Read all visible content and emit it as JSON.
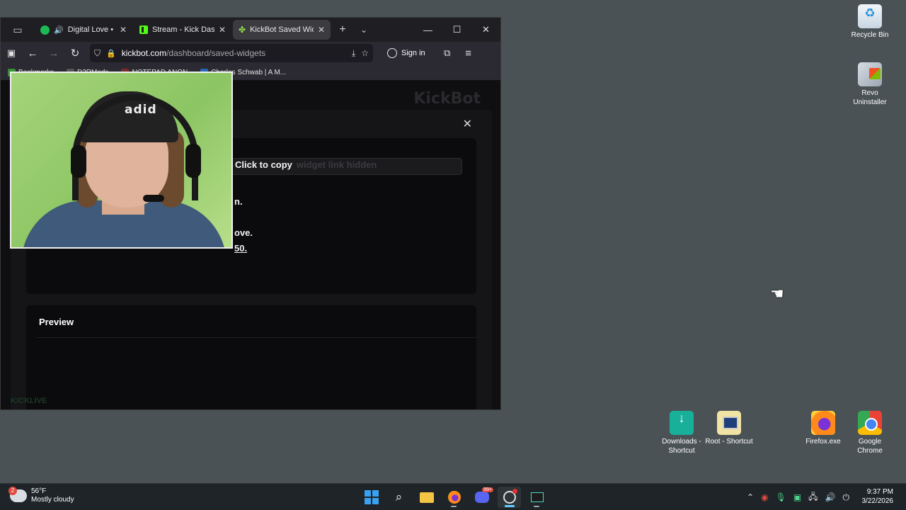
{
  "browser": {
    "tabs": [
      {
        "title": "Digital Love • Daft Punk",
        "favicon": "spotify-icon",
        "audio": true,
        "active": false
      },
      {
        "title": "Stream - Kick Dashboard",
        "favicon": "kick-icon",
        "audio": false,
        "active": false
      },
      {
        "title": "KickBot Saved Widgets",
        "favicon": "kickbot-icon",
        "audio": false,
        "active": true
      }
    ],
    "url": {
      "domain": "kickbot.com",
      "path": "/dashboard/saved-widgets"
    },
    "sign_in_label": "Sign in",
    "bookmarks": [
      {
        "label": "Bookmarks",
        "color": "#3a8f3a"
      },
      {
        "label": "D2RMods",
        "color": "#444"
      },
      {
        "label": "NOTEPAD ANON",
        "color": "#7a2a2a"
      },
      {
        "label": "Charles Schwab | A M...",
        "color": "#2a66b8"
      }
    ]
  },
  "page": {
    "bg_logo": "KickBot",
    "copy_button": "Click to copy",
    "copy_blurred": "widget link hidden",
    "line1": "n.",
    "line2": "ove.",
    "line3": "50.",
    "preview_title": "Preview",
    "footer": "KICKLIVE"
  },
  "webcam": {
    "beanie_text": "adid"
  },
  "desktop": {
    "icons": [
      {
        "label": "Recycle Bin",
        "icon": "recycle-bin-icon"
      },
      {
        "label": "Revo Uninstaller",
        "icon": "revo-uninstaller-icon"
      },
      {
        "label": "Downloads - Shortcut",
        "icon": "downloads-folder-icon"
      },
      {
        "label": "Root - Shortcut",
        "icon": "root-folder-icon"
      },
      {
        "label": "Firefox.exe",
        "icon": "firefox-icon"
      },
      {
        "label": "Google Chrome",
        "icon": "chrome-icon"
      }
    ]
  },
  "taskbar": {
    "weather_temp": "56°F",
    "weather_desc": "Mostly cloudy",
    "weather_badge": "2",
    "discord_badge": "99+",
    "time": "9:37 PM",
    "date": "3/22/2026"
  }
}
